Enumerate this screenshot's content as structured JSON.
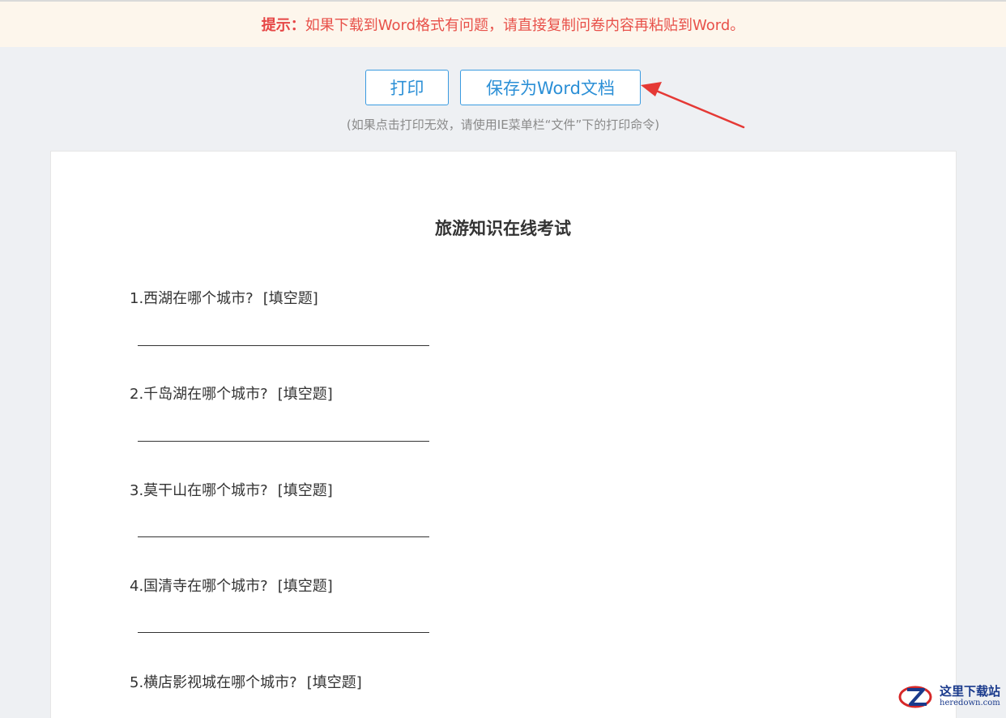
{
  "tip": {
    "label": "提示：",
    "text": "如果下载到Word格式有问题，请直接复制问卷内容再粘贴到Word。"
  },
  "toolbar": {
    "print_label": "打印",
    "save_word_label": "保存为Word文档",
    "note": "(如果点击打印无效，请使用IE菜单栏“文件”下的打印命令)"
  },
  "exam": {
    "title": "旅游知识在线考试",
    "questions": [
      {
        "text": "1.西湖在哪个城市?",
        "type": "[填空题]"
      },
      {
        "text": "2.千岛湖在哪个城市?",
        "type": "[填空题]"
      },
      {
        "text": "3.莫干山在哪个城市?",
        "type": "[填空题]"
      },
      {
        "text": "4.国清寺在哪个城市?",
        "type": "[填空题]"
      },
      {
        "text": "5.横店影视城在哪个城市?",
        "type": "[填空题]"
      }
    ]
  },
  "watermark": {
    "cn": "这里下载站",
    "en": "heredown.com"
  },
  "colors": {
    "tip_background": "#fdf6ec",
    "tip_text": "#e8514a",
    "button_accent": "#2b8fd6",
    "arrow": "#e53935"
  },
  "icons": {
    "annotation": "red-arrow-icon",
    "watermark_logo": "heredown-logo-icon"
  }
}
